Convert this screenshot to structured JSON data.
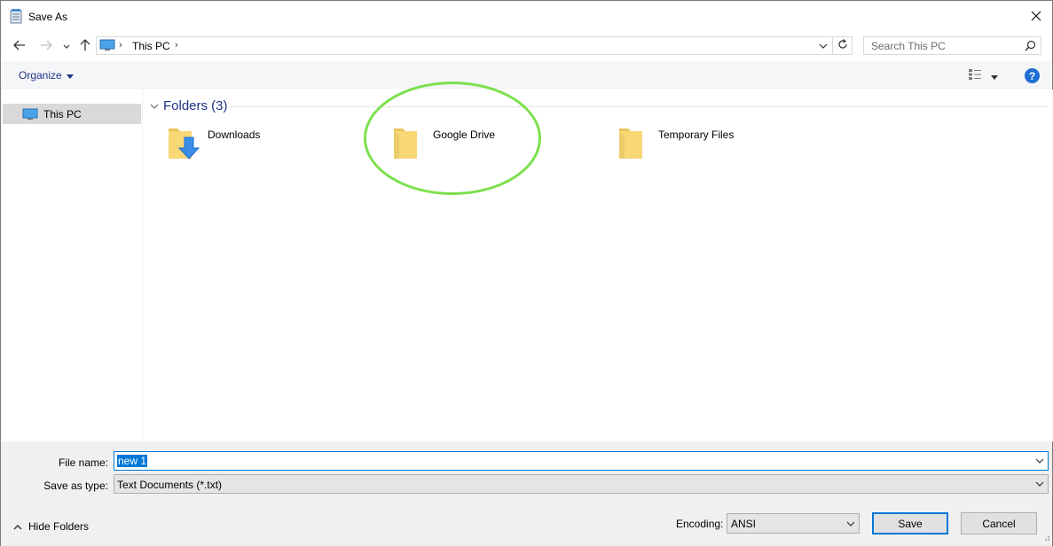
{
  "window": {
    "title": "Save As",
    "icon": "notepad-icon"
  },
  "nav": {
    "back_icon": "back-arrow-icon",
    "forward_icon": "forward-arrow-icon",
    "recent_icon": "chevron-down-icon",
    "up_icon": "up-arrow-icon",
    "address": {
      "icon": "this-pc-icon",
      "path": "This PC"
    },
    "refresh_icon": "refresh-icon",
    "search_placeholder": "Search This PC"
  },
  "toolbar": {
    "organize_label": "Organize",
    "view_icon": "view-options-icon",
    "help_icon": "help-icon",
    "help_label": "?"
  },
  "navpane": {
    "items": [
      {
        "label": "This PC",
        "icon": "this-pc-icon",
        "selected": true
      }
    ]
  },
  "content": {
    "group_label": "Folders (3)",
    "folders": [
      {
        "name": "Downloads",
        "icon": "downloads-folder-icon"
      },
      {
        "name": "Google Drive",
        "icon": "folder-icon",
        "highlighted": true
      },
      {
        "name": "Temporary Files",
        "icon": "folder-icon"
      }
    ],
    "highlight_color": "#7ce04d"
  },
  "form": {
    "filename_label": "File name:",
    "filename_value": "new 1",
    "type_label": "Save as type:",
    "type_value": "Text Documents (*.txt)",
    "hide_folders_label": "Hide Folders",
    "encoding_label": "Encoding:",
    "encoding_value": "ANSI",
    "save_label": "Save",
    "cancel_label": "Cancel"
  },
  "colors": {
    "accent": "#0078d7",
    "link": "#1e3287",
    "folder": "#f8d775"
  }
}
